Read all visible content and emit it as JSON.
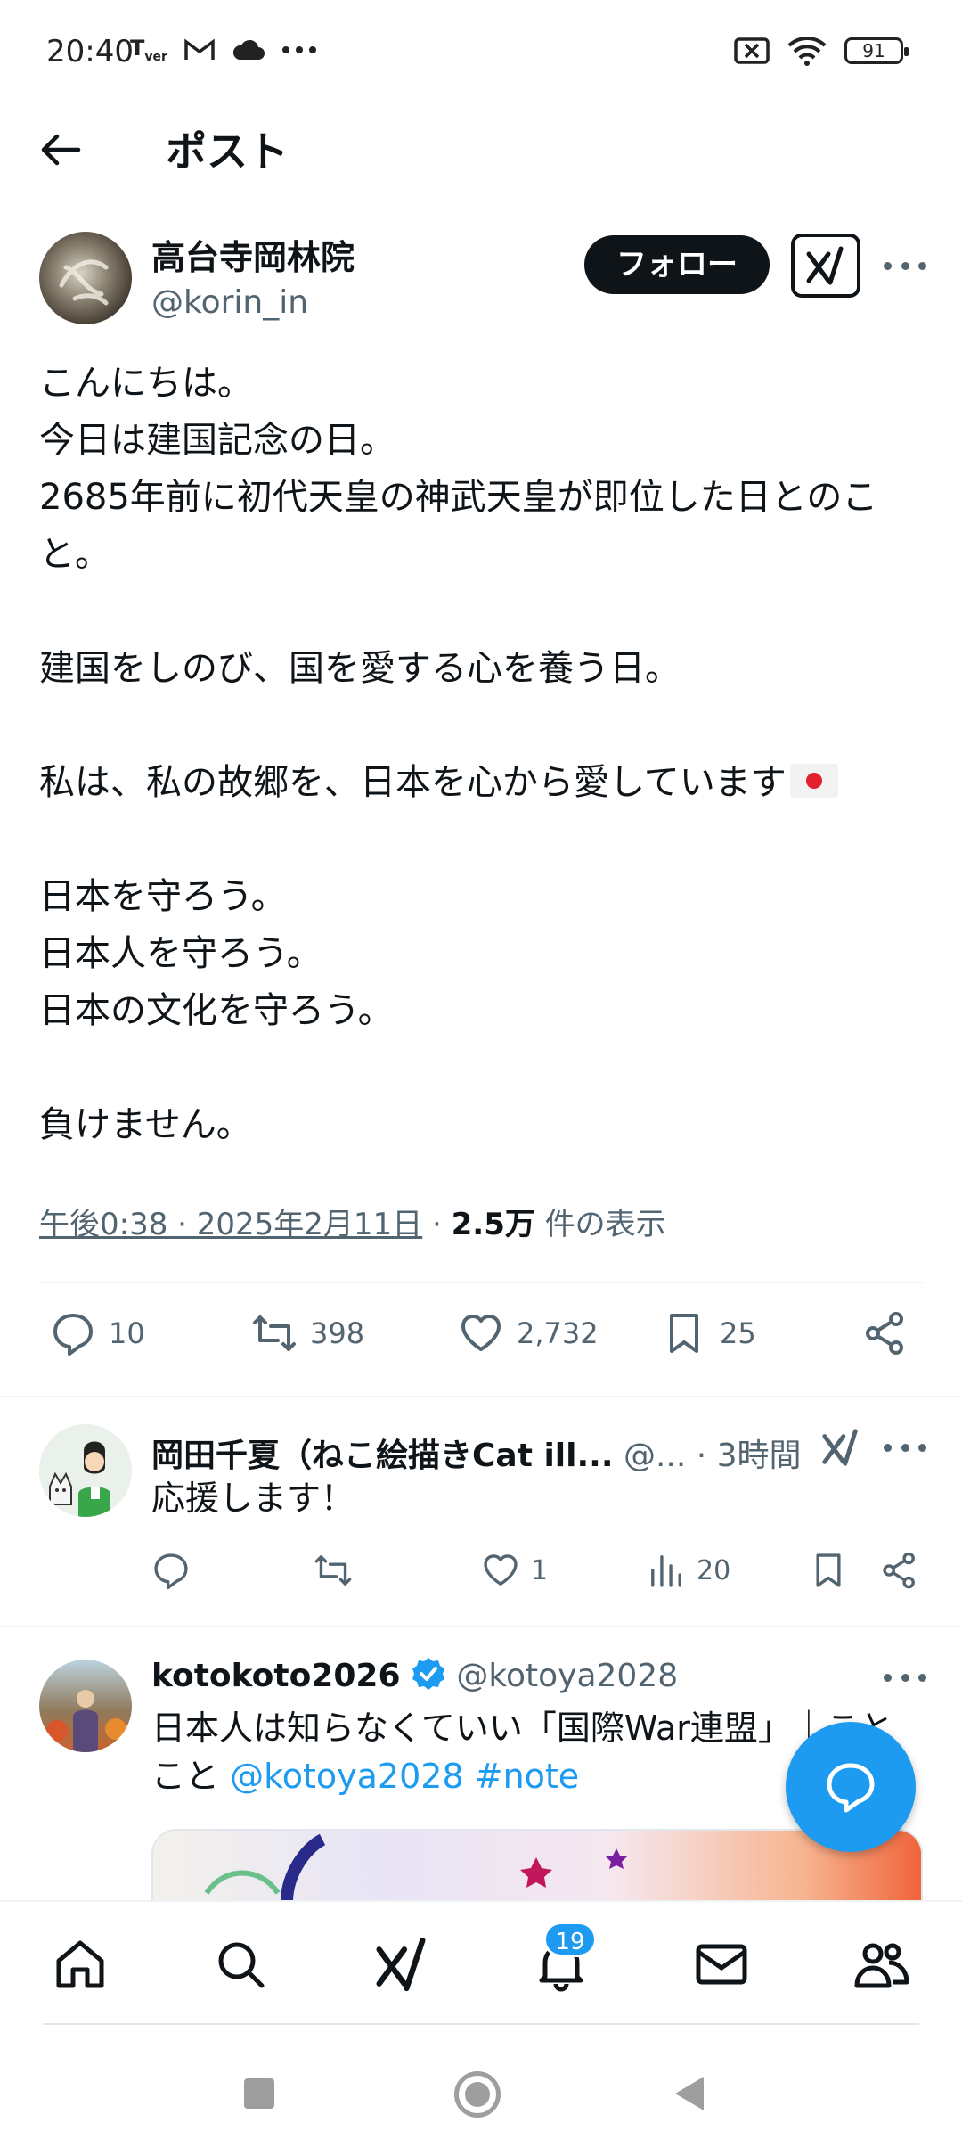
{
  "status_bar": {
    "time": "20:40",
    "left_icons": [
      "tver-icon",
      "gmail-icon",
      "cloud-icon",
      "more-dots-icon"
    ],
    "right_icons": [
      "no-sim-icon",
      "wifi-icon",
      "battery-icon"
    ],
    "battery_level": "91"
  },
  "header": {
    "title": "ポスト"
  },
  "post": {
    "author_name": "高台寺岡林院",
    "author_handle": "@korin_in",
    "follow_label": "フォロー",
    "lines": [
      "こんにちは。",
      "今日は建国記念の日。",
      "2685年前に初代天皇の神武天皇が即位した日とのこと。",
      "",
      "建国をしのび、国を愛する心を養う日。",
      "",
      "私は、私の故郷を、日本を心から愛しています",
      "",
      "日本を守ろう。",
      "日本人を守ろう。",
      "日本の文化を守ろう。",
      "",
      "負けません。"
    ],
    "timestamp": "午後0:38 · 2025年2月11日",
    "separator": "·",
    "view_count": "2.5万",
    "view_label": "件の表示",
    "stats": {
      "replies": "10",
      "reposts": "398",
      "likes": "2,732",
      "bookmarks": "25"
    }
  },
  "replies": [
    {
      "name": "岡田千夏（ねこ絵描きCat ill...",
      "handle": "@...",
      "time": "· 3時間",
      "text": "応援します！",
      "likes": "1",
      "views": "20"
    },
    {
      "name": "kotokoto2026",
      "handle": "@kotoya2028",
      "text_line1": "日本人は知らなくていい「国際War連盟」｜こと",
      "text_line2_prefix": "こと",
      "mention": "@kotoya2028",
      "hashtag": "#note"
    }
  ],
  "bottom_nav": {
    "items": [
      "home-icon",
      "search-icon",
      "grok-icon",
      "notifications-icon",
      "messages-icon",
      "communities-icon"
    ],
    "notification_badge": "19"
  },
  "colors": {
    "accent": "#1d9bf0",
    "text": "#0f1419",
    "secondary": "#536471"
  }
}
